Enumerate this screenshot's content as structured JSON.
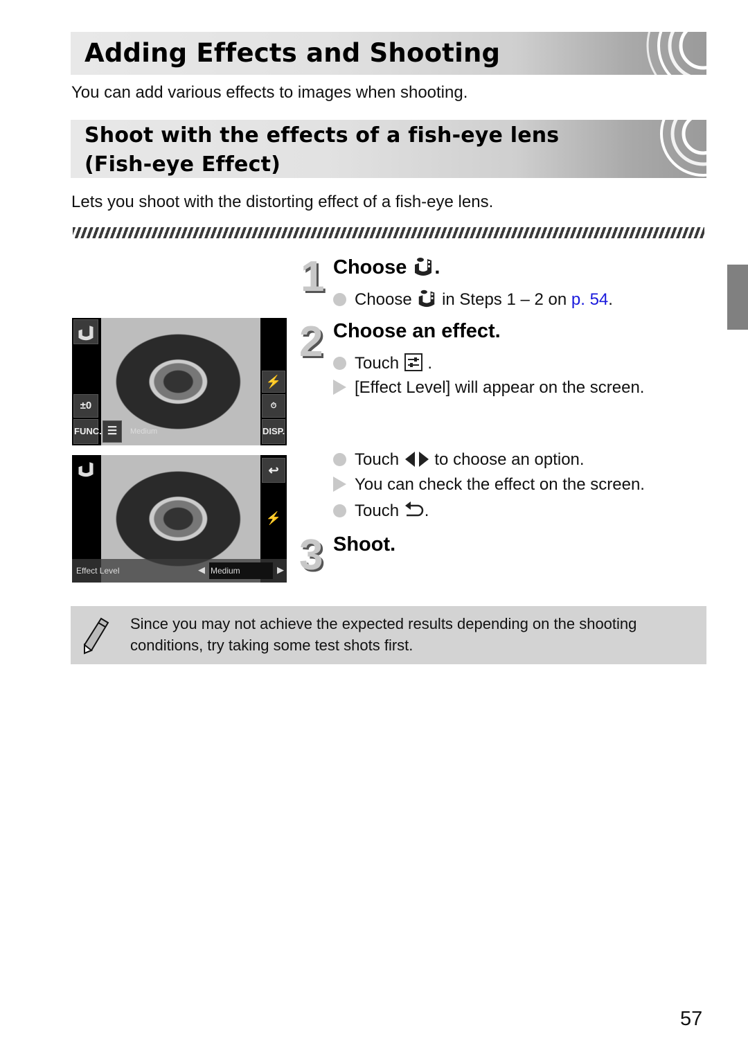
{
  "page": {
    "title": "Adding Effects and Shooting",
    "intro": "You can add various effects to images when shooting.",
    "page_number": "57"
  },
  "section": {
    "title_line1": "Shoot with the effects of a fish-eye lens",
    "title_line2": "(Fish-eye Effect)",
    "description": "Lets you shoot with the distorting effect of a fish-eye lens."
  },
  "steps": [
    {
      "number": "1",
      "heading_text": "Choose",
      "heading_icon": "fish-eye-mode-icon",
      "heading_suffix": ".",
      "items": [
        {
          "type": "bullet",
          "before": "Choose",
          "icon": "fish-eye-mode-icon",
          "after": "in Steps 1 – 2 on",
          "link": "p. 54",
          "end": "."
        }
      ]
    },
    {
      "number": "2",
      "heading_text": "Choose an effect.",
      "items": [
        {
          "type": "bullet",
          "before": "Touch",
          "icon": "effect-adjust-icon",
          "after": "."
        },
        {
          "type": "result",
          "text": "[Effect Level] will appear on the screen."
        },
        {
          "type": "bullet",
          "before": "Touch",
          "icon": "left-right-arrows-icon",
          "after": "to choose an option."
        },
        {
          "type": "result",
          "text": "You can check the effect on the screen."
        },
        {
          "type": "bullet",
          "before": "Touch",
          "icon": "return-icon",
          "after": "."
        }
      ]
    },
    {
      "number": "3",
      "heading_text": "Shoot."
    }
  ],
  "screens": [
    {
      "left_buttons": [
        "±0",
        "FUNC."
      ],
      "right_buttons": [
        "DISP."
      ],
      "bottom_label": "Medium"
    },
    {
      "effect_label": "Effect Level",
      "effect_value": "Medium"
    }
  ],
  "note": {
    "icon": "pencil-icon",
    "text": "Since you may not achieve the expected results depending on the shooting conditions, try taking some test shots first."
  },
  "colors": {
    "link": "#1a1adc",
    "bullet": "#c8c8c8",
    "note_bg": "#d3d3d3",
    "side_tab": "#808080"
  }
}
